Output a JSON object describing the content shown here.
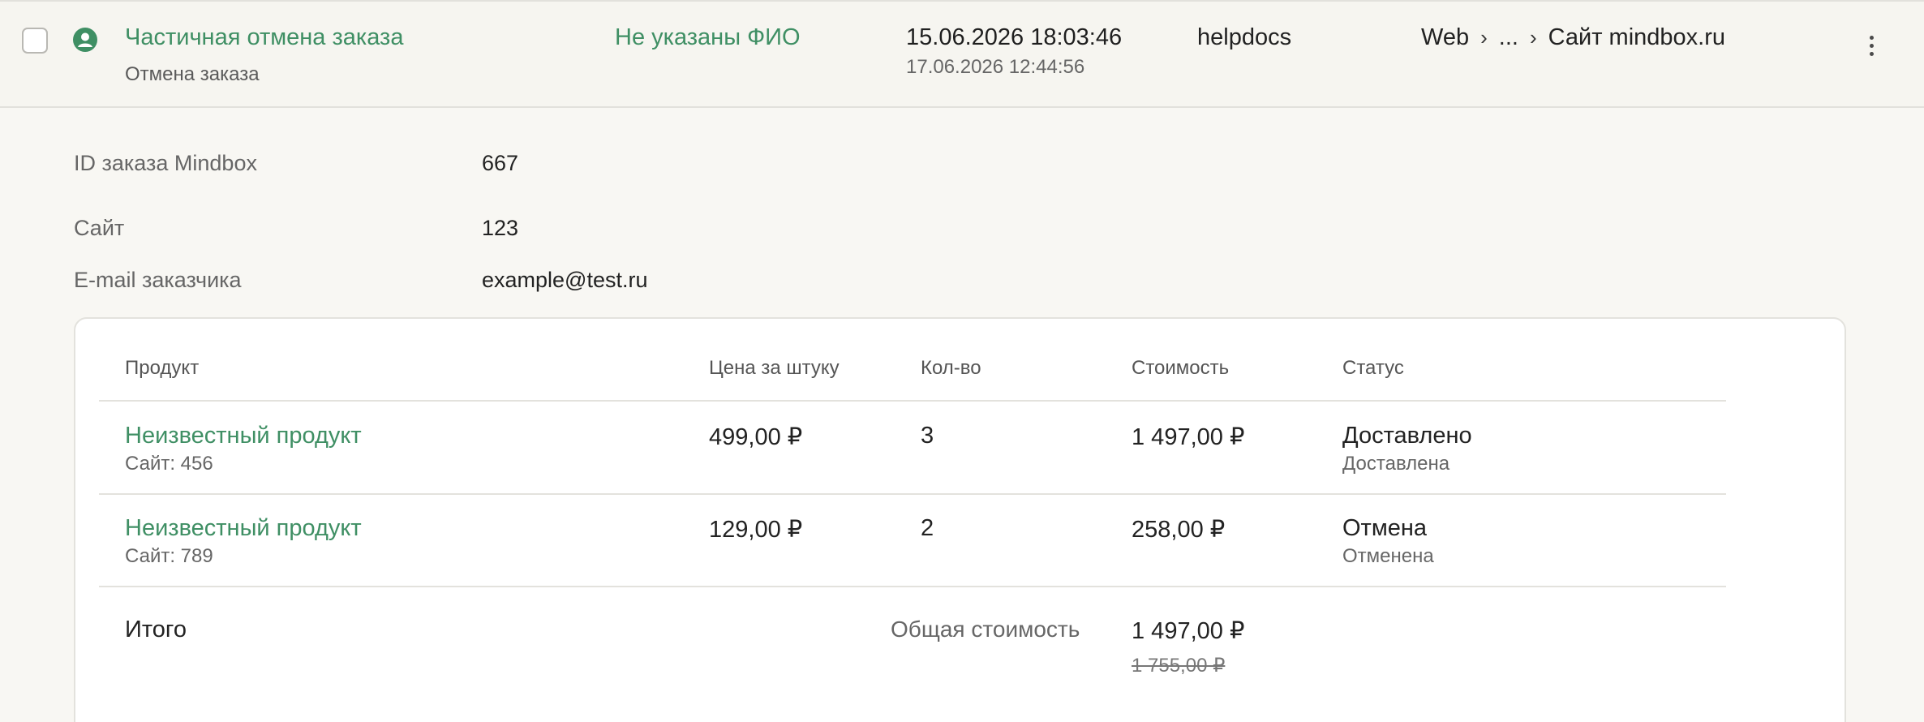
{
  "event": {
    "title": "Частичная отмена заказа",
    "subtitle": "Отмена заказа",
    "customer_name": "Не указаны ФИО",
    "date_main": "15.06.2026 18:03:46",
    "date_secondary": "17.06.2026 12:44:56",
    "channel": "helpdocs",
    "breadcrumb": [
      "Web",
      "...",
      "Сайт mindbox.ru"
    ],
    "icons": {
      "user": "user-circle-icon",
      "more": "kebab-menu-icon",
      "separator": "chevron-right-icon"
    },
    "accent_color": "#3f8f64"
  },
  "details": [
    {
      "label": "ID заказа Mindbox",
      "value": "667"
    },
    {
      "label": "Сайт",
      "value": "123"
    },
    {
      "label": "E-mail заказчика",
      "value": "example@test.ru"
    }
  ],
  "products": {
    "columns": [
      "Продукт",
      "Цена за штуку",
      "Кол-во",
      "Стоимость",
      "Статус"
    ],
    "rows": [
      {
        "name": "Неизвестный продукт",
        "site": "Сайт: 456",
        "price": "499,00 ₽",
        "qty": "3",
        "cost": "1 497,00 ₽",
        "status": "Доставлено",
        "status_sub": "Доставлена"
      },
      {
        "name": "Неизвестный продукт",
        "site": "Сайт: 789",
        "price": "129,00 ₽",
        "qty": "2",
        "cost": "258,00 ₽",
        "status": "Отмена",
        "status_sub": "Отменена"
      }
    ],
    "total": {
      "label": "Итого",
      "cost_label": "Общая стоимость",
      "cost": "1 497,00 ₽",
      "old_cost": "1 755,00 ₽"
    }
  }
}
